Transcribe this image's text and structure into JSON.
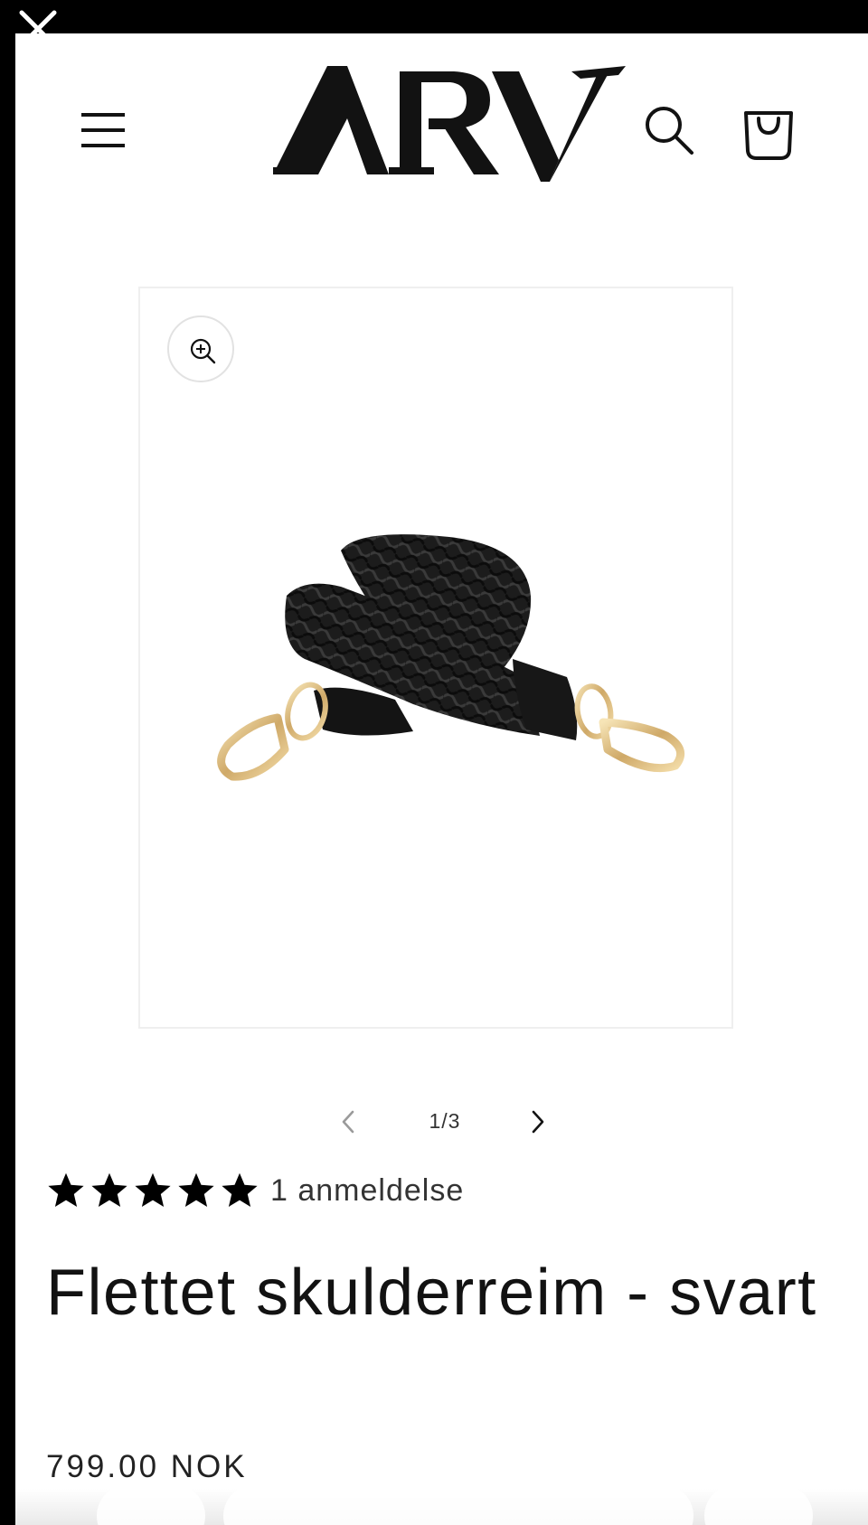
{
  "overlay": {
    "close_icon": "close-icon"
  },
  "header": {
    "logo_text": "ARV",
    "icons": {
      "menu": "hamburger-menu-icon",
      "search": "search-icon",
      "cart": "shopping-bag-icon"
    }
  },
  "gallery": {
    "zoom_icon": "zoom-in-icon",
    "current": 1,
    "total": 3,
    "counter": "1/3",
    "image_alt": "Black braided shoulder strap with gold clasps"
  },
  "product": {
    "rating": 5,
    "rating_max": 5,
    "review_count_label": "1 anmeldelse",
    "title": "Flettet skulderreim - svart",
    "price": "799.00 NOK"
  },
  "colors": {
    "text": "#121212",
    "background": "#ffffff",
    "frame": "#000000",
    "star": "#000000"
  }
}
